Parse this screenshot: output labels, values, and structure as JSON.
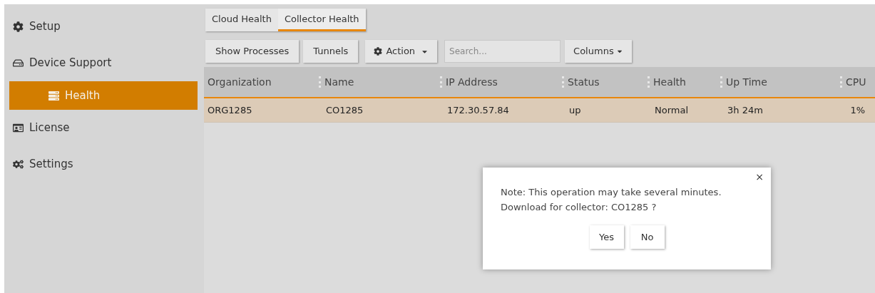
{
  "sidebar": {
    "items": [
      {
        "label": "Setup",
        "selected": false
      },
      {
        "label": "Device Support",
        "selected": false,
        "children": [
          {
            "label": "Health",
            "selected": true
          }
        ]
      },
      {
        "label": "License",
        "selected": false
      },
      {
        "label": "Settings",
        "selected": false
      }
    ]
  },
  "tabs": [
    {
      "label": "Cloud Health",
      "selected": false
    },
    {
      "label": "Collector Health",
      "selected": true
    }
  ],
  "toolbar": [
    {
      "kind": "button",
      "label": "Show Processes"
    },
    {
      "kind": "button",
      "label": "Tunnels"
    },
    {
      "kind": "action-menu",
      "label": "Action"
    },
    {
      "kind": "search",
      "placeholder": "Search..."
    },
    {
      "kind": "menu",
      "label": "Columns"
    }
  ],
  "table": {
    "columns": [
      "Organization",
      "Name",
      "IP Address",
      "Status",
      "Health",
      "Up Time",
      "CPU"
    ],
    "rows": [
      {
        "selected": true,
        "cells": [
          "ORG1285",
          "CO1285",
          "172.30.57.84",
          "up",
          "Normal",
          "3h 24m",
          "1%"
        ]
      }
    ]
  },
  "dialog": {
    "close": "×",
    "message_lines": [
      "Note: This operation may take several minutes.",
      "Download for collector: CO1285 ?"
    ],
    "buttons": [
      "Yes",
      "No"
    ]
  }
}
